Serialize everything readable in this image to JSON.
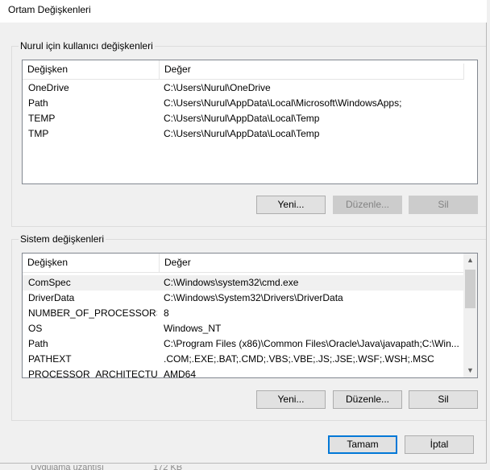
{
  "window": {
    "title": "Ortam Değişkenleri"
  },
  "user_vars": {
    "group_title": "Nurul için kullanıcı değişkenleri",
    "columns": [
      "Değişken",
      "Değer"
    ],
    "rows": [
      {
        "name": "OneDrive",
        "value": "C:\\Users\\Nurul\\OneDrive"
      },
      {
        "name": "Path",
        "value": "C:\\Users\\Nurul\\AppData\\Local\\Microsoft\\WindowsApps;"
      },
      {
        "name": "TEMP",
        "value": "C:\\Users\\Nurul\\AppData\\Local\\Temp"
      },
      {
        "name": "TMP",
        "value": "C:\\Users\\Nurul\\AppData\\Local\\Temp"
      }
    ],
    "buttons": {
      "new": "Yeni...",
      "edit": "Düzenle...",
      "delete": "Sil"
    }
  },
  "system_vars": {
    "group_title": "Sistem değişkenleri",
    "columns": [
      "Değişken",
      "Değer"
    ],
    "rows": [
      {
        "name": "ComSpec",
        "value": "C:\\Windows\\system32\\cmd.exe"
      },
      {
        "name": "DriverData",
        "value": "C:\\Windows\\System32\\Drivers\\DriverData"
      },
      {
        "name": "NUMBER_OF_PROCESSORS",
        "value": "8"
      },
      {
        "name": "OS",
        "value": "Windows_NT"
      },
      {
        "name": "Path",
        "value": "C:\\Program Files (x86)\\Common Files\\Oracle\\Java\\javapath;C:\\Win..."
      },
      {
        "name": "PATHEXT",
        "value": ".COM;.EXE;.BAT;.CMD;.VBS;.VBE;.JS;.JSE;.WSF;.WSH;.MSC"
      },
      {
        "name": "PROCESSOR_ARCHITECTURE",
        "value": "AMD64"
      }
    ],
    "buttons": {
      "new": "Yeni...",
      "edit": "Düzenle...",
      "delete": "Sil"
    }
  },
  "dialog_buttons": {
    "ok": "Tamam",
    "cancel": "İptal"
  },
  "background_window": {
    "label": "Uygulama uzantısı",
    "value": "172 KB"
  },
  "colors": {
    "accent": "#0078d7",
    "list_border": "#828790",
    "button_face": "#e1e1e1"
  }
}
